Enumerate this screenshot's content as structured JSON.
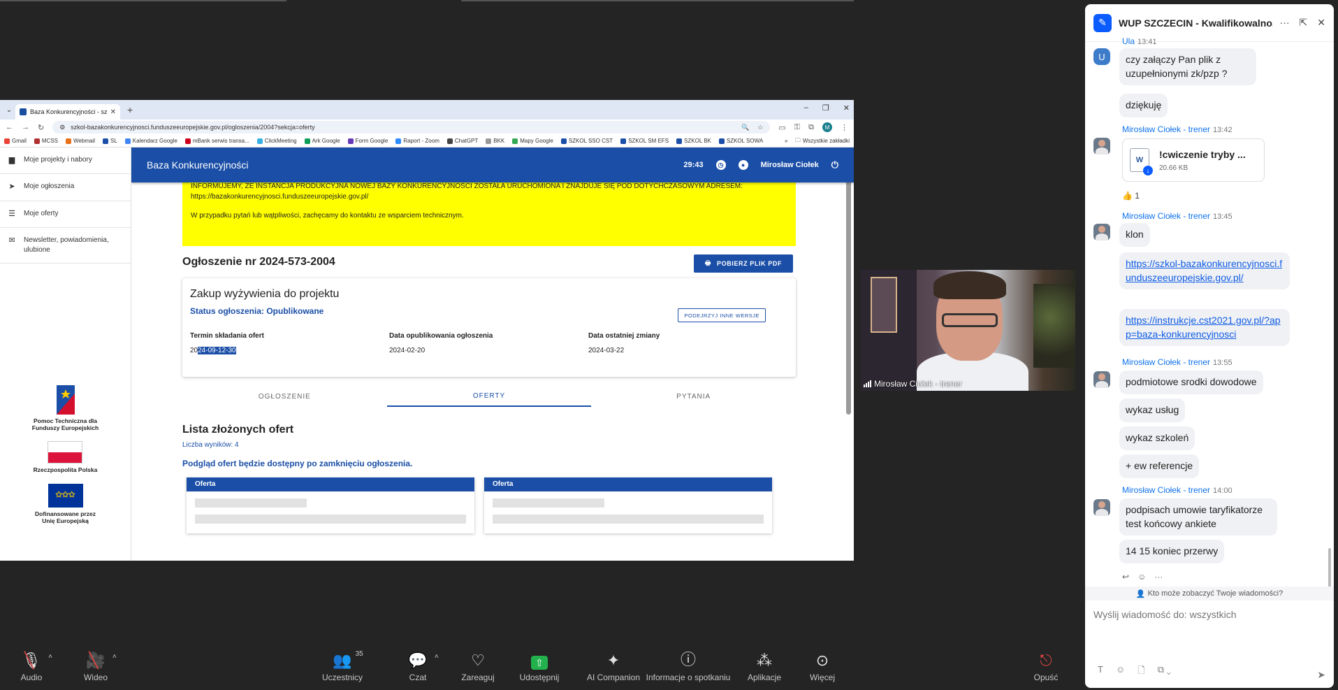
{
  "browser": {
    "tab_title": "Baza Konkurencyjności - szczeg",
    "url": "szkol-bazakonkurencyjnosci.funduszeeuropejskie.gov.pl/ogloszenia/2004?sekcja=oferty",
    "profile_initial": "M",
    "bookmarks": [
      "Gmail",
      "MCSS",
      "Webmail",
      "SL",
      "Kalendarz Google",
      "mBank serwis transa...",
      "ClickMeeting",
      "Ark Google",
      "Form Google",
      "Raport - Zoom",
      "ChatGPT",
      "BKK",
      "Mapy Google",
      "SZKOL SSO CST",
      "SZKOL SM EFS",
      "SZKOL BK",
      "SZKOL SOWA"
    ],
    "bookmarks_all": "Wszystkie zakładki"
  },
  "sidebar": {
    "items": [
      {
        "label": "Moje projekty i nabory",
        "icon": "chat-icon"
      },
      {
        "label": "Moje ogłoszenia",
        "icon": "send-icon"
      },
      {
        "label": "Moje oferty",
        "icon": "list-icon"
      },
      {
        "label": "Newsletter, powiadomienia, ulubione",
        "icon": "mail-icon"
      }
    ],
    "logos": [
      {
        "caption": "Pomoc Techniczna dla Funduszy Europejskich"
      },
      {
        "caption": "Rzeczpospolita Polska"
      },
      {
        "caption": "Dofinansowane przez Unię Europejską"
      }
    ]
  },
  "header": {
    "app_title": "Baza Konkurencyjności",
    "timer": "29:43",
    "user_name": "Mirosław Ciołek"
  },
  "notice": {
    "line1": "INFORMUJEMY, ŻE INSTANCJA PRODUKCYJNA NOWEJ BAZY KONKURENCYJNOŚCI ZOSTAŁA URUCHOMIONA I ZNAJDUJE SIĘ POD DOTYCHCZASOWYM ADRESEM: https://bazakonkurencyjnosci.funduszeeuropejskie.gov.pl/",
    "line2": "W przypadku pytań lub wątpliwości, zachęcamy do kontaktu ze wsparciem technicznym."
  },
  "offer": {
    "title": "Ogłoszenie nr 2024-573-2004",
    "pdf_button": "POBIERZ PLIK PDF",
    "card_title": "Zakup wyżywienia do projektu",
    "status": "Status ogłoszenia: Opublikowane",
    "versions_button": "PODEJRZYJ INNE WERSJE",
    "fields": [
      {
        "label": "Termin składania ofert",
        "value_plain": "20",
        "value_selected": "24-09-12-30"
      },
      {
        "label": "Data opublikowania ogłoszenia",
        "value_plain": "2024-02-20",
        "value_selected": ""
      },
      {
        "label": "Data ostatniej zmiany",
        "value_plain": "2024-03-22",
        "value_selected": ""
      }
    ],
    "tabs": [
      "OGŁOSZENIE",
      "OFERTY",
      "PYTANIA"
    ],
    "active_tab": "OFERTY",
    "list_title": "Lista złożonych ofert",
    "results": "Liczba wyników: 4",
    "preview_note": "Podgląd ofert będzie dostępny po zamknięciu ogłoszenia.",
    "offer_cards": [
      "Oferta",
      "Oferta"
    ]
  },
  "video": {
    "participant": "Mirosław Ciołek - trener"
  },
  "chat": {
    "title": "WUP SZCZECIN - Kwalifikowalno...",
    "messages": [
      {
        "sender": "Ula",
        "time": "13:41",
        "avatar": "U",
        "bubbles": [
          "czy załączy Pan plik z uzupełnionymi zk/pzp ?",
          "dziękuję"
        ]
      },
      {
        "sender": "Mirosław Ciołek - trener",
        "time": "13:42",
        "file": {
          "name": "!cwiczenie tryby ...",
          "size": "20.66 KB",
          "icon": "W"
        },
        "reaction": "👍 1"
      },
      {
        "sender": "Mirosław Ciołek - trener",
        "time": "13:45",
        "bubbles": [
          "klon",
          "https://szkol-bazakonkurencyjnosci.funduszeeuropejskie.gov.pl/",
          "https://instrukcje.cst2021.gov.pl/?app=baza-konkurencyjnosci"
        ]
      },
      {
        "sender": "Mirosław Ciołek - trener",
        "time": "13:55",
        "bubbles": [
          "podmiotowe srodki dowodowe",
          "wykaz usług",
          "wykaz szkoleń",
          "+ ew referencje"
        ]
      },
      {
        "sender": "Mirosław Ciołek - trener",
        "time": "14:00",
        "bubbles": [
          "podpisach umowie taryfikatorze test końcowy ankiete",
          "14 15 koniec przerwy"
        ]
      }
    ],
    "who_can_see": "Kto może zobaczyć Twoje wiadomości?",
    "input_placeholder": "Wyślij wiadomość do: wszystkich"
  },
  "toolbar": {
    "audio": "Audio",
    "video": "Wideo",
    "participants": "Uczestnicy",
    "participants_count": "35",
    "chat": "Czat",
    "react": "Zareaguj",
    "share": "Udostępnij",
    "ai": "AI Companion",
    "info": "Informacje o spotkaniu",
    "apps": "Aplikacje",
    "more": "Więcej",
    "leave": "Opuść"
  }
}
